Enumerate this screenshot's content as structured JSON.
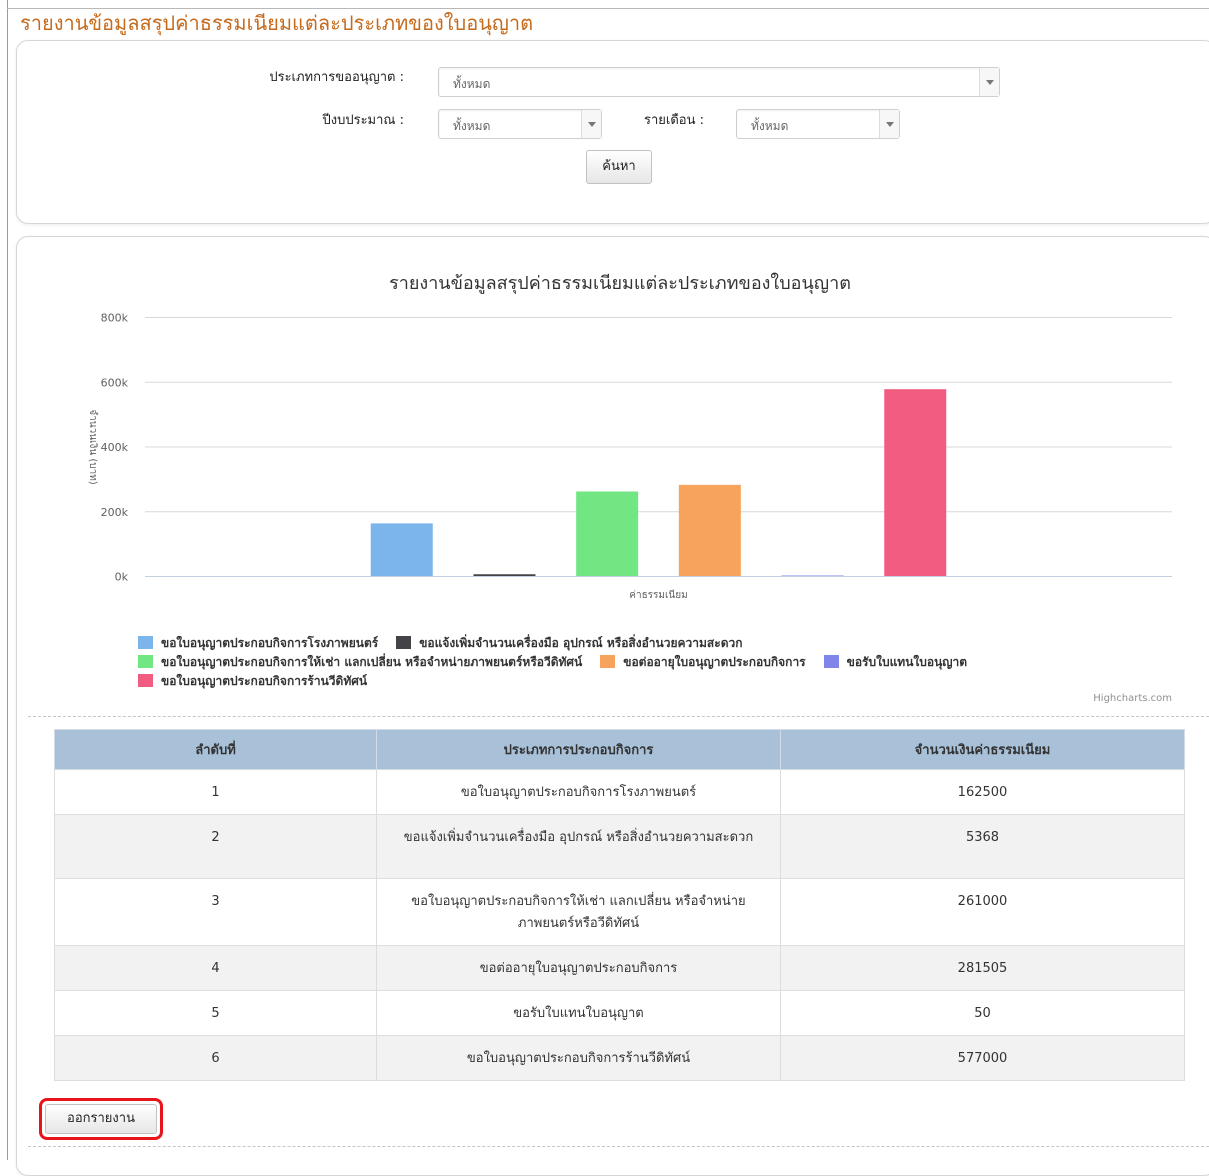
{
  "page": {
    "title": "รายงานข้อมูลสรุปค่าธรรมเนียมแต่ละประเภทของใบอนุญาต"
  },
  "filters": {
    "license_type": {
      "label": "ประเภทการขออนุญาต :",
      "value": "ทั้งหมด"
    },
    "fiscal_year": {
      "label": "ปีงบประมาณ :",
      "value": "ทั้งหมด"
    },
    "monthly": {
      "label": "รายเดือน :",
      "value": "ทั้งหมด"
    },
    "search_label": "ค้นหา"
  },
  "chart_data": {
    "type": "bar",
    "title": "รายงานข้อมูลสรุปค่าธรรมเนียมแต่ละประเภทของใบอนุญาต",
    "xlabel": "ค่าธรรมเนียม",
    "ylabel": "จำนวนเงิน (บาท)",
    "ylim": [
      0,
      800000
    ],
    "yticks": [
      "0k",
      "200k",
      "400k",
      "600k",
      "800k"
    ],
    "grid": true,
    "legend_position": "bottom",
    "credits": "Highcharts.com",
    "series": [
      {
        "name": "ขอใบอนุญาตประกอบกิจการโรงภาพยนตร์",
        "value": 162500,
        "color": "#7cb5ec"
      },
      {
        "name": "ขอแจ้งเพิ่มจำนวนเครื่องมือ อุปกรณ์ หรือสิ่งอำนวยความสะดวก",
        "value": 5368,
        "color": "#434348"
      },
      {
        "name": "ขอใบอนุญาตประกอบกิจการให้เช่า แลกเปลี่ยน หรือจำหน่ายภาพยนตร์หรือวีดิทัศน์",
        "value": 261000,
        "color": "#72e683"
      },
      {
        "name": "ขอต่ออายุใบอนุญาตประกอบกิจการ",
        "value": 281505,
        "color": "#f7a35c"
      },
      {
        "name": "ขอรับใบแทนใบอนุญาต",
        "value": 50,
        "color": "#8085e9"
      },
      {
        "name": "ขอใบอนุญาตประกอบกิจการร้านวีดิทัศน์",
        "value": 577000,
        "color": "#f15c80"
      }
    ]
  },
  "table": {
    "headers": [
      "ลำดับที่",
      "ประเภทการประกอบกิจการ",
      "จำนวนเงินค่าธรรมเนียม"
    ],
    "rows": [
      [
        "1",
        "ขอใบอนุญาตประกอบกิจการโรงภาพยนตร์",
        "162500"
      ],
      [
        "2",
        "ขอแจ้งเพิ่มจำนวนเครื่องมือ อุปกรณ์ หรือสิ่งอำนวยความสะดวก",
        "5368"
      ],
      [
        "3",
        "ขอใบอนุญาตประกอบกิจการให้เช่า แลกเปลี่ยน หรือจำหน่ายภาพยนตร์หรือวีดิทัศน์",
        "261000"
      ],
      [
        "4",
        "ขอต่ออายุใบอนุญาตประกอบกิจการ",
        "281505"
      ],
      [
        "5",
        "ขอรับใบแทนใบอนุญาต",
        "50"
      ],
      [
        "6",
        "ขอใบอนุญาตประกอบกิจการร้านวีดิทัศน์",
        "577000"
      ]
    ]
  },
  "export_label": "ออกรายงาน"
}
